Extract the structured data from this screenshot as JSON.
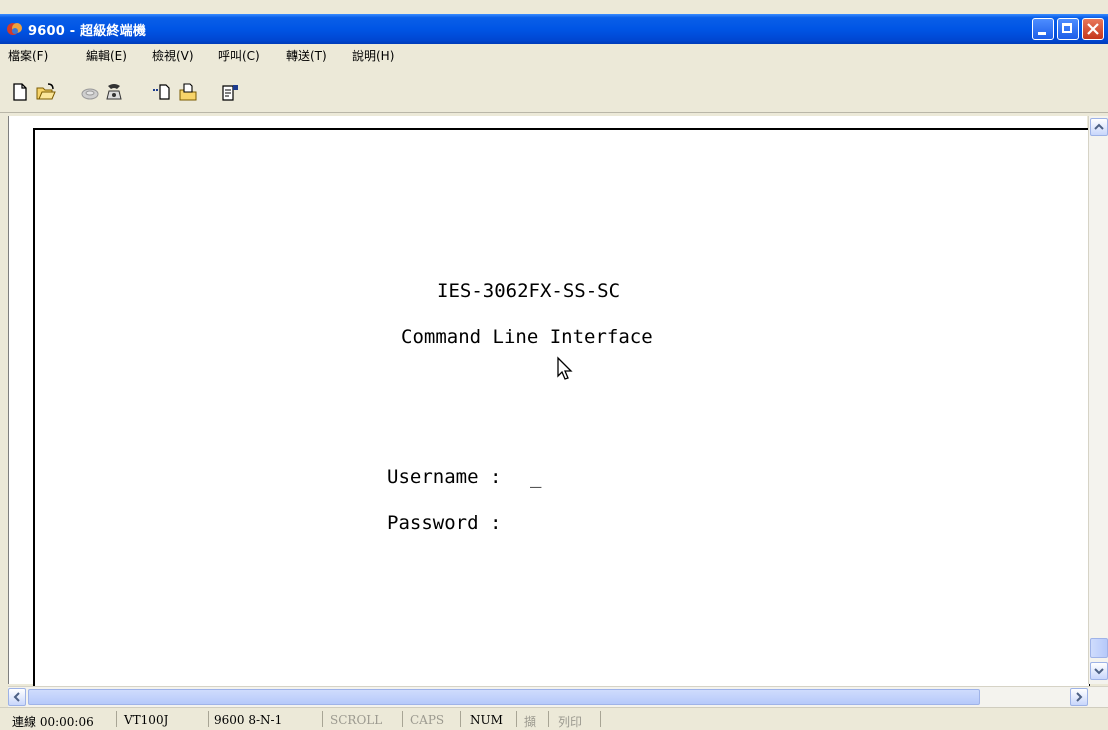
{
  "window": {
    "title": "9600 - 超級終端機"
  },
  "menu": [
    "檔案(F)",
    "編輯(E)",
    "檢視(V)",
    "呼叫(C)",
    "轉送(T)",
    "說明(H)"
  ],
  "toolbar": [
    "new-icon",
    "open-icon",
    "disconnect-icon",
    "dial-icon",
    "send-icon",
    "receive-icon",
    "properties-icon"
  ],
  "terminal": {
    "model": "IES-3062FX-SS-SC",
    "interface": "Command Line Interface",
    "username_label": "Username : ",
    "username_cursor": "_",
    "password_label": "Password :"
  },
  "status": {
    "connected": "連線 00:00:06",
    "emulation": "VT100J",
    "settings": "9600 8-N-1",
    "scroll": "SCROLL",
    "caps": "CAPS",
    "num": "NUM",
    "capture": "擷",
    "print": "列印"
  },
  "colors": {
    "titlebar": "#0055e5",
    "close": "#c4361c",
    "scroll_thumb": "#b6c9fa"
  }
}
